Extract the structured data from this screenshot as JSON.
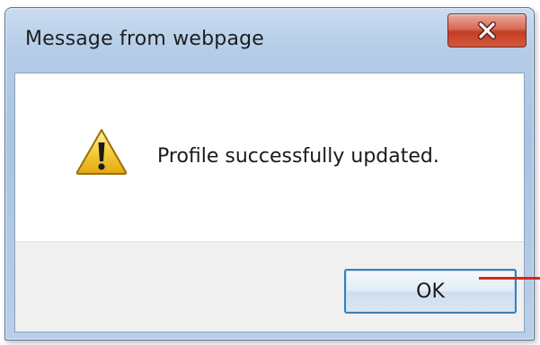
{
  "dialog": {
    "title": "Message from webpage",
    "message": "Profile successfully updated.",
    "ok_label": "OK",
    "close_symbol": "x"
  },
  "icons": {
    "close": "close-icon",
    "warning": "warning-icon"
  },
  "colors": {
    "close_button": "#c94a33",
    "ok_border": "#3c7fb1",
    "annotation_line": "#d8261c",
    "warning_fill": "#f2c230"
  }
}
